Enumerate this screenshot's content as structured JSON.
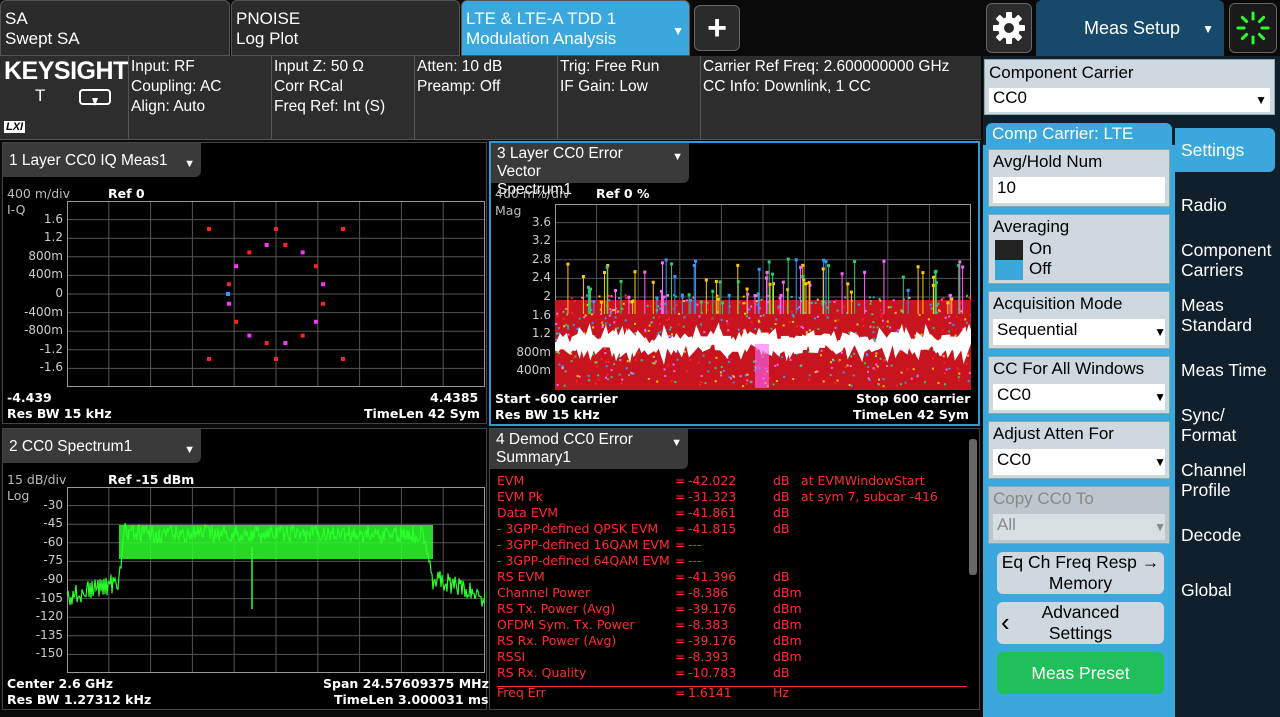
{
  "tabs": [
    {
      "line1": "SA",
      "line2": "Swept SA"
    },
    {
      "line1": "PNOISE",
      "line2": "Log Plot"
    },
    {
      "line1": "LTE & LTE-A TDD 1",
      "line2": "Modulation Analysis"
    }
  ],
  "add_tab": "+",
  "meas_setup": "Meas Setup",
  "brand": {
    "name": "KEYSIGHT",
    "t_label": "T",
    "lxi": "LXI"
  },
  "info": {
    "c1": [
      "Input: RF",
      "Coupling: AC",
      "Align: Auto"
    ],
    "c2": [
      "Input Z: 50 Ω",
      "Corr RCal",
      "Freq Ref: Int (S)"
    ],
    "c3": [
      "Atten: 10 dB",
      "Preamp: Off"
    ],
    "c4": [
      "Trig: Free Run",
      "IF Gain: Low"
    ],
    "c5": [
      "Carrier Ref Freq: 2.600000000 GHz",
      "CC Info: Downlink, 1 CC"
    ]
  },
  "win1": {
    "title": "1 Layer CC0 IQ Meas1",
    "scale": "400 m/div",
    "ref": "Ref 0",
    "unit": "I-Q",
    "yticks": [
      "1.6",
      "1.2",
      "800m",
      "400m",
      "0",
      "-400m",
      "-800m",
      "-1.2",
      "-1.6"
    ],
    "xmin": "-4.439",
    "xmax": "4.4385",
    "resbw": "Res BW 15 kHz",
    "timelen": "TimeLen 42  Sym"
  },
  "win2": {
    "title": "2 CC0 Spectrum1",
    "scale": "15 dB/div",
    "ref": "Ref -15 dBm",
    "unit": "Log",
    "yticks": [
      "-30",
      "-45",
      "-60",
      "-75",
      "-90",
      "-105",
      "-120",
      "-135",
      "-150"
    ],
    "center": "Center 2.6 GHz",
    "span": "Span 24.57609375 MHz",
    "resbw": "Res BW 1.27312 kHz",
    "timelen": "TimeLen 3.000031 ms"
  },
  "win3": {
    "title_l1": "3 Layer CC0 Error Vector",
    "title_l2": "Spectrum1",
    "scale": "400 m%/div",
    "ref": "Ref 0 %",
    "unit": "Mag",
    "yticks": [
      "3.6",
      "3.2",
      "2.8",
      "2.4",
      "2",
      "1.6",
      "1.2",
      "800m",
      "400m"
    ],
    "start": "Start -600  carrier",
    "stop": "Stop 600  carrier",
    "resbw": "Res BW 15 kHz",
    "timelen": "TimeLen 42  Sym"
  },
  "win4": {
    "title_l1": "4 Demod CC0 Error",
    "title_l2": "Summary1",
    "rows": [
      {
        "name": "EVM",
        "eq": "=",
        "val": "-42.022",
        "unit": "dB",
        "extra": "at  EVMWindowStart"
      },
      {
        "name": "EVM Pk",
        "eq": "=",
        "val": "-31.323",
        "unit": "dB",
        "extra": "at  sym 7,   subcar  -416"
      },
      {
        "name": "Data EVM",
        "eq": "=",
        "val": "-41.861",
        "unit": "dB",
        "extra": ""
      },
      {
        "name": " - 3GPP-defined QPSK EVM",
        "eq": "=",
        "val": "-41.815",
        "unit": "dB",
        "extra": ""
      },
      {
        "name": " - 3GPP-defined 16QAM EVM",
        "eq": "=",
        "val": "---",
        "unit": "",
        "extra": ""
      },
      {
        "name": " - 3GPP-defined 64QAM EVM",
        "eq": "=",
        "val": "---",
        "unit": "",
        "extra": ""
      },
      {
        "name": "RS EVM",
        "eq": "=",
        "val": "-41.396",
        "unit": "dB",
        "extra": ""
      },
      {
        "name": "Channel Power",
        "eq": "=",
        "val": "-8.386",
        "unit": "dBm",
        "extra": ""
      },
      {
        "name": "RS Tx. Power (Avg)",
        "eq": "=",
        "val": "-39.176",
        "unit": "dBm",
        "extra": ""
      },
      {
        "name": "OFDM Sym. Tx. Power",
        "eq": "=",
        "val": "-8.383",
        "unit": "dBm",
        "extra": ""
      },
      {
        "name": "RS Rx. Power (Avg)",
        "eq": "=",
        "val": "-39.176",
        "unit": "dBm",
        "extra": ""
      },
      {
        "name": "RSSI",
        "eq": "=",
        "val": "-8.393",
        "unit": "dBm",
        "extra": ""
      },
      {
        "name": "RS Rx. Quality",
        "eq": "=",
        "val": "-10.783",
        "unit": "dB",
        "extra": ""
      },
      {
        "name": "Freq Err",
        "eq": "=",
        "val": "1.6141",
        "unit": "Hz",
        "extra": ""
      }
    ]
  },
  "panel": {
    "component_carrier": {
      "label": "Component Carrier",
      "value": "CC0"
    },
    "group_title": "Comp Carrier: LTE",
    "avg_hold": {
      "label": "Avg/Hold Num",
      "value": "10"
    },
    "averaging": {
      "label": "Averaging",
      "on": "On",
      "off": "Off"
    },
    "acq_mode": {
      "label": "Acquisition Mode",
      "value": "Sequential"
    },
    "cc_all": {
      "label": "CC For All Windows",
      "value": "CC0"
    },
    "adj_atten": {
      "label": "Adjust Atten For",
      "value": "CC0"
    },
    "copy_cc0": {
      "label": "Copy CC0 To",
      "value": "All"
    },
    "eq_btn": [
      "Eq Ch Freq Resp →",
      "Memory"
    ],
    "adv_btn": [
      "Advanced",
      "Settings"
    ],
    "preset_btn": "Meas Preset"
  },
  "menu": [
    {
      "label": "Settings"
    },
    {
      "label": "Radio"
    },
    {
      "label": "Component Carriers"
    },
    {
      "label": "Meas Standard"
    },
    {
      "label": "Meas Time"
    },
    {
      "label": "Sync/ Format"
    },
    {
      "label": "Channel Profile"
    },
    {
      "label": "Decode"
    },
    {
      "label": "Global"
    }
  ],
  "colors": {
    "accent": "#3aa8dd",
    "trace_green": "#2bff2b",
    "error_red": "#ff2d2d",
    "panel_bg": "#0f1f2c",
    "preset_green": "#1fbf5a"
  }
}
